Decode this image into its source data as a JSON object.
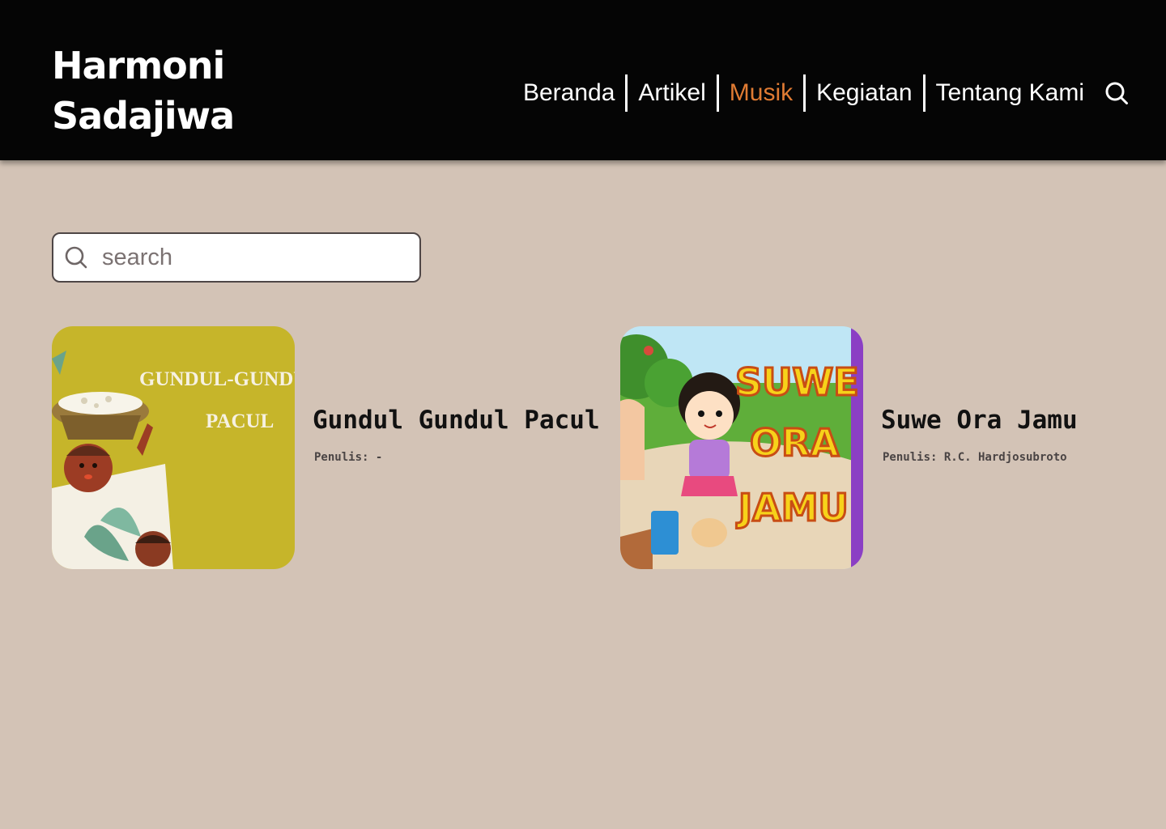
{
  "brand": {
    "line1": "Harmoni",
    "line2": "Sadajiwa"
  },
  "nav": {
    "items": [
      {
        "label": "Beranda",
        "active": false
      },
      {
        "label": "Artikel",
        "active": false
      },
      {
        "label": "Musik",
        "active": true
      },
      {
        "label": "Kegiatan",
        "active": false
      },
      {
        "label": "Tentang Kami",
        "active": false
      }
    ],
    "search_icon": "search-icon"
  },
  "search": {
    "placeholder": "search"
  },
  "songs": [
    {
      "title": "Gundul Gundul Pacul",
      "writer": "Penulis: -",
      "cover_text_1": "GUNDUL-GUNDUL",
      "cover_text_2": "PACUL"
    },
    {
      "title": "Suwe Ora Jamu",
      "writer": "Penulis: R.C. Hardjosubroto",
      "cover_text_1": "SUWE",
      "cover_text_2": "ORA",
      "cover_text_3": "JAMU"
    }
  ],
  "colors": {
    "background": "#d3c3b6",
    "header": "#050505",
    "accent": "#e07b33"
  }
}
